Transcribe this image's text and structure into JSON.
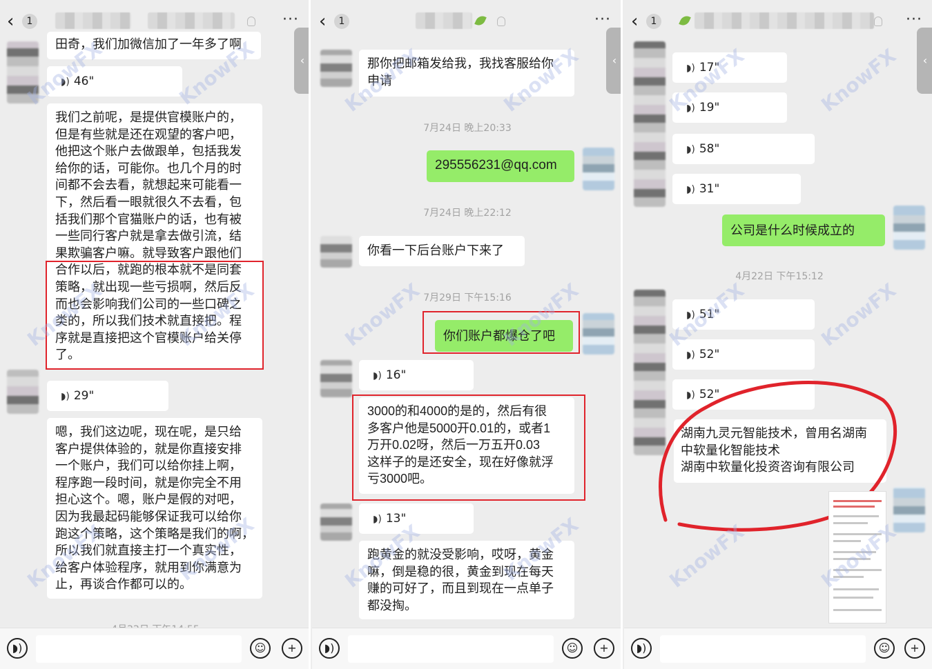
{
  "colors": {
    "green_bubble": "#95ec69",
    "red_annotation": "#e0232b",
    "watermark": "#a0afe1"
  },
  "panel1": {
    "back_count": "1",
    "top_text": "田奇，我们加微信加了一年多了啊",
    "voice1": "46\"",
    "msg1": "我们之前呢，是提供官模账户的，\n但是有些就是还在观望的客户吧，\n他把这个账户去做跟单，包括我发\n给你的话，可能你。也几个月的时\n间都不会去看，就想起来可能看一\n下，然后看一眼就很久不去看，包\n括我们那个官猫账户的话，也有被\n一些同行客户就是拿去做引流，结\n果欺骗客户嘛。就导致客户跟他们\n合作以后，就跑的根本就不是同套\n策略，就出现一些亏损啊，然后反\n而也会影响我们公司的一些口碑之\n类的，所以我们技术就直接把。程\n序就是直接把这个官模账户给关停\n了。",
    "voice2": "29\"",
    "msg2": "嗯，我们这边呢，现在呢，是只给\n客户提供体验的，就是你直接安排\n一个账户，我们可以给你挂上啊，\n程序跑一段时间，就是你完全不用\n担心这个。嗯，账户是假的对吧，\n因为我最起码能够保证我可以给你\n跑这个策略，这个策略是我们的啊，\n所以我们就直接主打一个真实性，\n给客户体验程序，就用到你满意为\n止，再谈合作都可以的。",
    "bottom_time": "4月22日 下午14:55"
  },
  "panel2": {
    "back_count": "1",
    "msg1": "那你把邮箱发给我，我找客服给你\n申请",
    "time1": "7月24日 晚上20:33",
    "email": "295556231@qq.com",
    "time2": "7月24日 晚上22:12",
    "msg2": "你看一下后台账户下来了",
    "time3": "7月29日 下午15:16",
    "msg3": "你们账户都爆仓了吧",
    "voice1": "16\"",
    "msg4": "3000的和4000的是的，然后有很\n多客户他是5000开0.01的，或者1\n万开0.02呀，然后一万五开0.03\n这样子的是还安全，现在好像就浮\n亏3000吧。",
    "voice2": "13\"",
    "msg5": "跑黄金的就没受影响，哎呀，黄金\n嘛，倒是稳的很，黄金到现在每天\n赚的可好了，而且到现在一点单子\n都没掏。"
  },
  "panel3": {
    "back_count": "1",
    "voices_top": [
      "17\"",
      "19\"",
      "58\"",
      "31\""
    ],
    "msg1": "公司是什么时候成立的",
    "time1": "4月22日 下午15:12",
    "voices_bottom": [
      "51\"",
      "52\"",
      "52\""
    ],
    "msg2": "湖南九灵元智能技术，曾用名湖南\n中软量化智能技术\n湖南中软量化投资咨询有限公司"
  },
  "icons": {
    "back": "‹",
    "more": "···",
    "voice_wave": "◗)",
    "side_tab": "‹"
  },
  "watermark_text": "KnowFX"
}
